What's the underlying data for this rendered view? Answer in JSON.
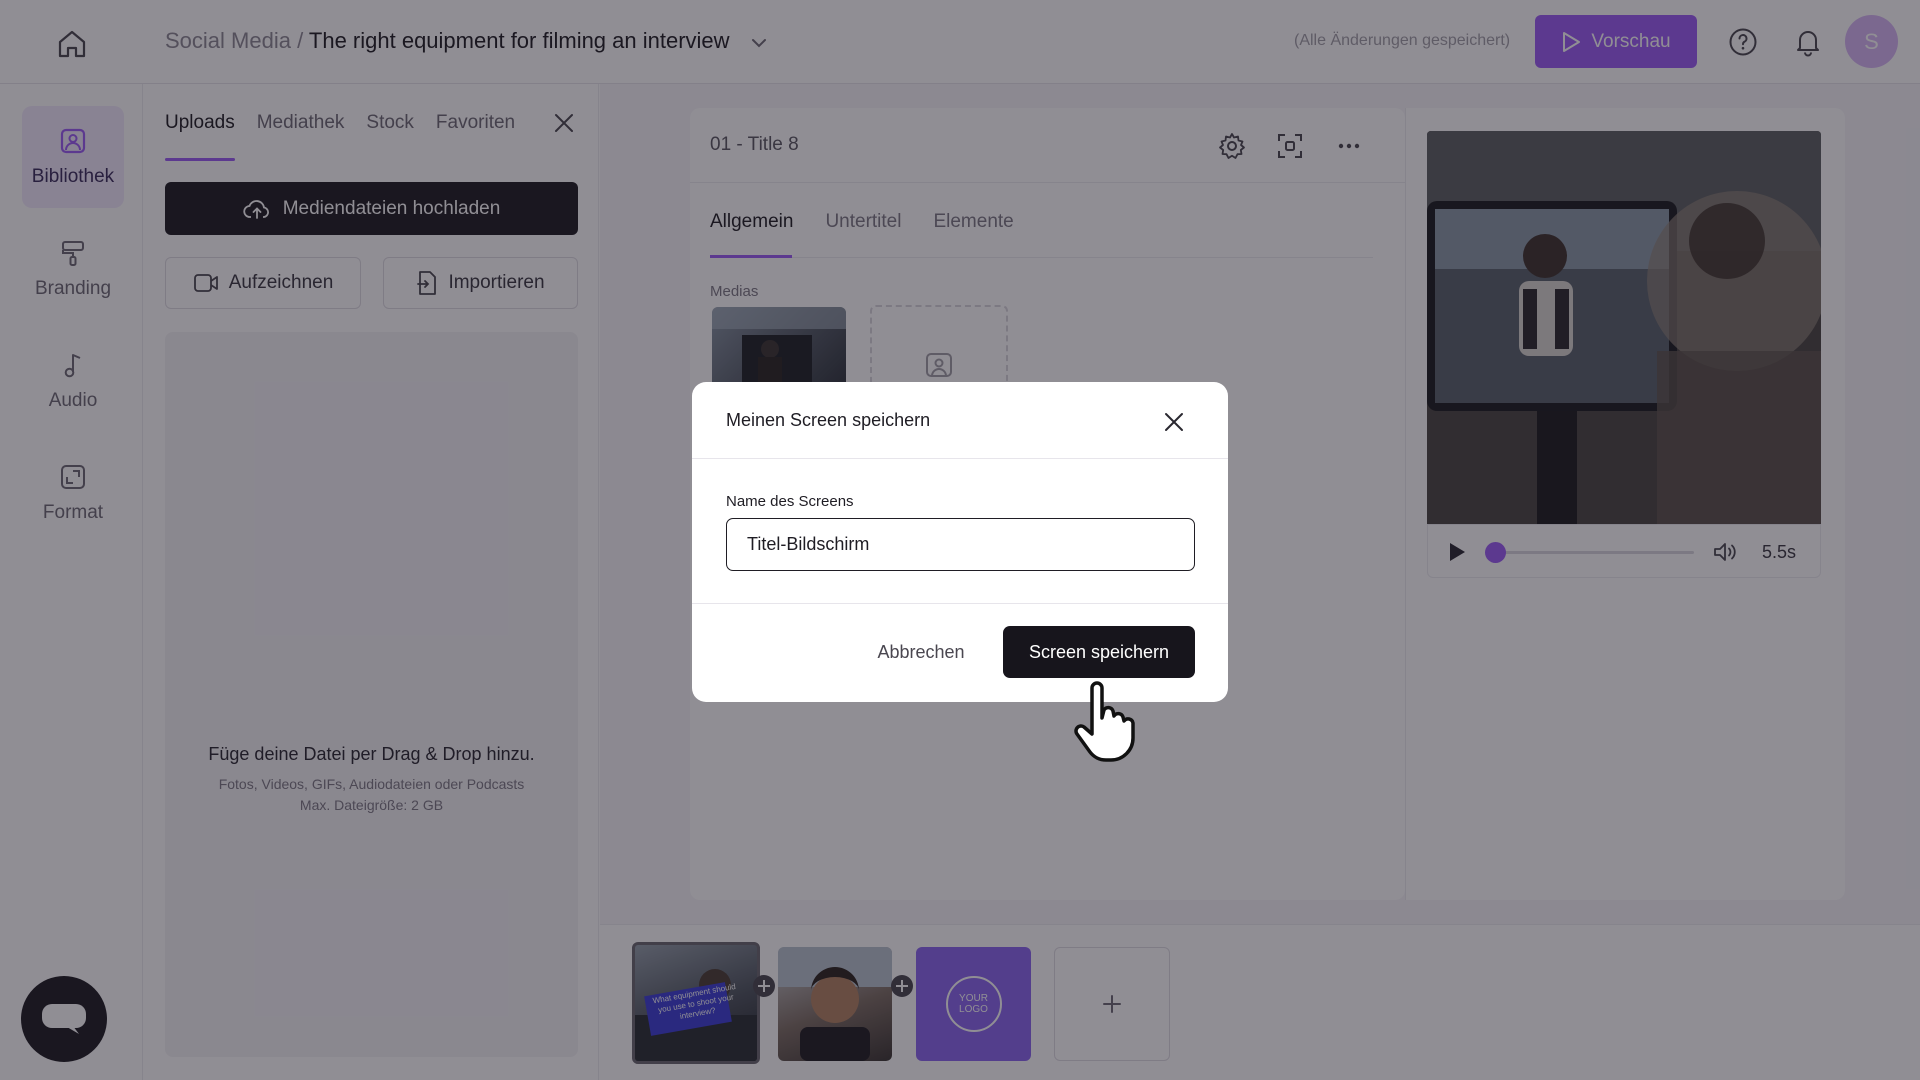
{
  "topbar": {
    "breadcrumb_parent": "Social Media",
    "breadcrumb_sep": " / ",
    "breadcrumb_title": "The right equipment for filming an interview",
    "save_status": "(Alle Änderungen gespeichert)",
    "preview_label": "Vorschau",
    "avatar_initial": "S"
  },
  "rail": {
    "items": [
      {
        "label": "Bibliothek",
        "icon": "image-icon"
      },
      {
        "label": "Branding",
        "icon": "paint-roller-icon"
      },
      {
        "label": "Audio",
        "icon": "music-note-icon"
      },
      {
        "label": "Format",
        "icon": "resize-icon"
      }
    ]
  },
  "library": {
    "tabs": [
      "Uploads",
      "Mediathek",
      "Stock",
      "Favoriten"
    ],
    "active_tab": "Uploads",
    "upload_label": "Mediendateien hochladen",
    "record_label": "Aufzeichnen",
    "import_label": "Importieren",
    "drop_title": "Füge deine Datei per Drag & Drop hinzu.",
    "drop_types": "Fotos, Videos, GIFs, Audiodateien oder Podcasts",
    "drop_limit": "Max. Dateigröße: 2 GB"
  },
  "editor": {
    "screen_title": "01 - Title 8",
    "tabs": [
      "Allgemein",
      "Untertitel",
      "Elemente"
    ],
    "active_tab": "Allgemein",
    "medias_label": "Medias"
  },
  "player": {
    "duration": "5.5s",
    "progress": 0.0
  },
  "timeline": {
    "slide1_caption": "What equipment should you use to shoot your interview?",
    "logo_text": "YOUR LOGO"
  },
  "modal": {
    "title": "Meinen Screen speichern",
    "field_label": "Name des Screens",
    "field_value": "Titel-Bildschirm",
    "cancel_label": "Abbrechen",
    "save_label": "Screen speichern"
  },
  "colors": {
    "accent": "#9b5cf6",
    "dark_button": "#17151c",
    "overlay": "rgba(22,18,32,0.48)"
  }
}
